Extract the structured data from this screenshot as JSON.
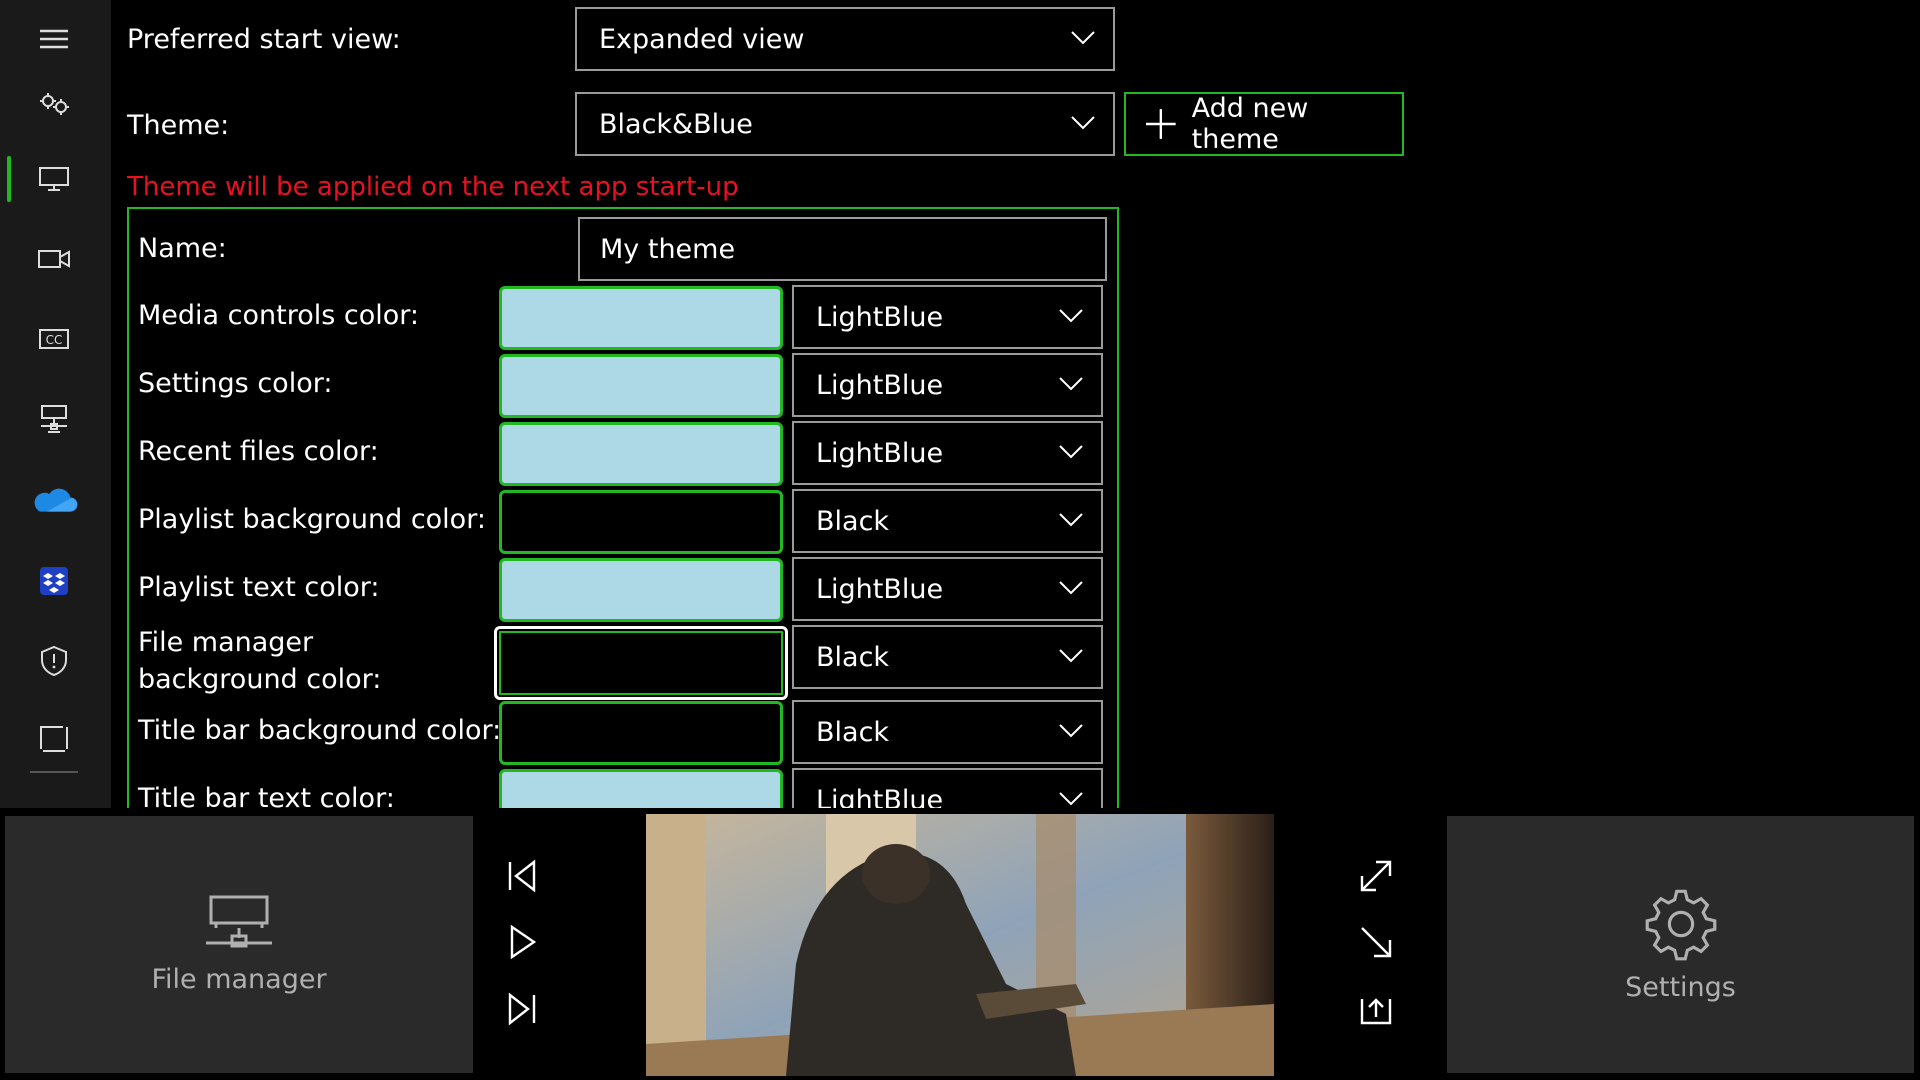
{
  "settings": {
    "start_view_label": "Preferred start view:",
    "start_view_value": "Expanded view",
    "theme_label": "Theme:",
    "theme_value": "Black&Blue",
    "add_theme_label": "Add new theme",
    "warning": "Theme will be applied on the next app start-up"
  },
  "theme_editor": {
    "name_label": "Name:",
    "name_value": "My theme",
    "rows": [
      {
        "label": "Media controls color:",
        "value": "LightBlue",
        "swatch": "#add8e6"
      },
      {
        "label": "Settings color:",
        "value": "LightBlue",
        "swatch": "#add8e6"
      },
      {
        "label": "Recent files color:",
        "value": "LightBlue",
        "swatch": "#add8e6"
      },
      {
        "label": "Playlist background color:",
        "value": "Black",
        "swatch": "#000000"
      },
      {
        "label": "Playlist text color:",
        "value": "LightBlue",
        "swatch": "#add8e6"
      },
      {
        "label": "File manager background color:",
        "value": "Black",
        "swatch": "#000000"
      },
      {
        "label": "Title bar background color:",
        "value": "Black",
        "swatch": "#000000"
      },
      {
        "label": "Title bar text color:",
        "value": "LightBlue",
        "swatch": "#add8e6"
      }
    ]
  },
  "sidebar": {
    "icons": [
      "hamburger-menu-icon",
      "gears-icon",
      "monitor-icon",
      "video-camera-icon",
      "closed-captions-icon",
      "network-icon",
      "onedrive-icon",
      "dropbox-icon",
      "shield-icon",
      "window-icon"
    ],
    "active_index": 2
  },
  "bottom_bar": {
    "file_manager_label": "File manager",
    "settings_label": "Settings"
  },
  "colors": {
    "accent": "#22b822",
    "warning": "#e81123",
    "light_blue": "#add8e6",
    "rail_bg": "#1a1a1a",
    "tile_bg": "#2a2a2a"
  }
}
